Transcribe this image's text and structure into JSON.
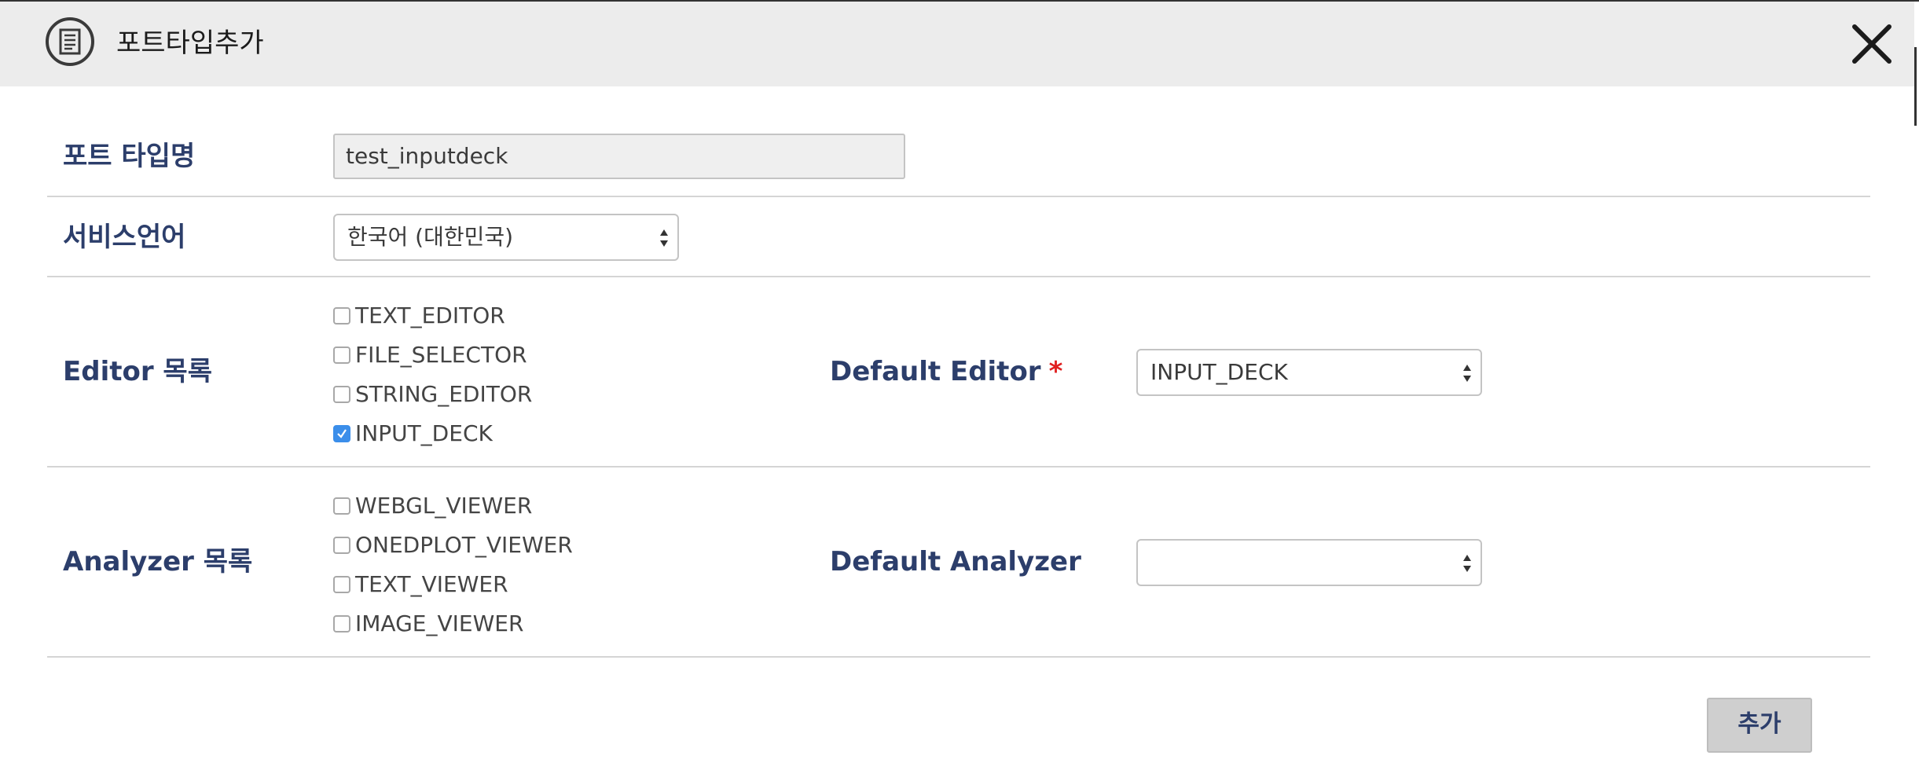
{
  "dialog": {
    "title": "포트타입추가",
    "close_icon": "close-icon",
    "header_icon": "document-icon"
  },
  "port_type_name": {
    "label": "포트 타입명",
    "value": "test_inputdeck"
  },
  "service_language": {
    "label": "서비스언어",
    "selected": "한국어 (대한민국)"
  },
  "editors": {
    "label": "Editor 목록",
    "items": [
      {
        "label": "TEXT_EDITOR",
        "checked": false
      },
      {
        "label": "FILE_SELECTOR",
        "checked": false
      },
      {
        "label": "STRING_EDITOR",
        "checked": false
      },
      {
        "label": "INPUT_DECK",
        "checked": true
      }
    ],
    "default_label": "Default Editor",
    "required_mark": "*",
    "default_selected": "INPUT_DECK"
  },
  "analyzers": {
    "label": "Analyzer 목록",
    "items": [
      {
        "label": "WEBGL_VIEWER",
        "checked": false
      },
      {
        "label": "ONEDPLOT_VIEWER",
        "checked": false
      },
      {
        "label": "TEXT_VIEWER",
        "checked": false
      },
      {
        "label": "IMAGE_VIEWER",
        "checked": false
      }
    ],
    "default_label": "Default Analyzer",
    "default_selected": ""
  },
  "footer": {
    "add_label": "추가"
  },
  "colors": {
    "label_text": "#2c3e6b",
    "header_bg": "#ececec",
    "checkbox_checked": "#3b8eea",
    "required_star": "#e02020",
    "button_bg": "#cfcfcf"
  }
}
